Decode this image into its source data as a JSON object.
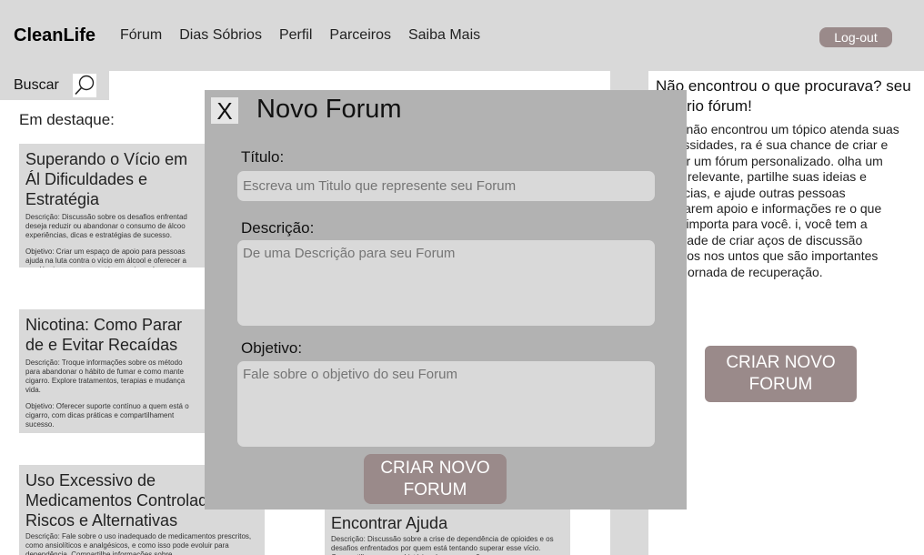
{
  "header": {
    "brand": "CleanLife",
    "nav": [
      "Fórum",
      "Dias Sóbrios",
      "Perfil",
      "Parceiros",
      "Saiba Mais"
    ],
    "logout_label": "Log-out"
  },
  "search": {
    "label": "Buscar",
    "icon": "search-icon"
  },
  "featured_label": "Em destaque:",
  "cards": [
    {
      "title": "Superando o Vício em Ál Dificuldades e Estratégia",
      "description": "Descrição: Discussão sobre os desafios enfrentad deseja reduzir ou abandonar o consumo de álcoo experiências, dicas e estratégias de sucesso.",
      "objective": "Objetivo: Criar um espaço de apoio para pessoas ajuda na luta contra o vício em álcool e oferecer a saudáveis para quem está nessa jornada."
    },
    {
      "title": "Nicotina: Como Parar de e Evitar Recaídas",
      "description": "Descrição: Troque informações sobre os método para abandonar o hábito de fumar e como mante cigarro. Explore tratamentos, terapias e mudança vida.",
      "objective": "Objetivo: Oferecer suporte contínuo a quem está o cigarro, com dicas práticas e compartilhament sucesso."
    },
    {
      "title": "Uso Excessivo de Medicamentos Controlad Riscos e Alternativas",
      "description": "Descrição: Fale sobre o uso inadequado de medicamentos prescritos, como ansiolíticos e analgésicos, e como isso pode evoluir para dependência. Compartilhe informações sobre",
      "objective": ""
    },
    {
      "title": "Encontrar Ajuda",
      "description": "Descrição: Discussão sobre a crise de dependência de opioides e os desafios enfrentados por quem está tentando superar esse vício. Compartilhe recursos, histórias de recuperação e",
      "objective": ""
    }
  ],
  "right_panel": {
    "title": "Não encontrou o que procurava? seu próprio fórum!",
    "text": "você não encontrou um tópico atenda suas necessidades, ra é sua chance de criar e enciar um fórum personalizado. olha um tema relevante, partilhe suas ideias e eriências, e ajude outras pessoas contrarem apoio e informações re o que mais importa para você. i, você tem a liberdade de criar aços de discussão focados nos untos que são importantes para jornada de recuperação.",
    "button_label": "CRIAR NOVO FORUM"
  },
  "modal": {
    "close_label": "X",
    "title": "Novo Forum",
    "title_label": "Título:",
    "title_placeholder": "Escreva um Titulo que represente seu Forum",
    "desc_label": "Descrição:",
    "desc_placeholder": "De uma Descrição para seu Forum",
    "obj_label": "Objetivo:",
    "obj_placeholder": "Fale sobre o objetivo do seu Forum",
    "submit_label": "CRIAR NOVO FORUM"
  },
  "colors": {
    "button": "#9a8a8a",
    "modal_bg": "#b2b2b2",
    "panel_gray": "#d9d9d9"
  }
}
